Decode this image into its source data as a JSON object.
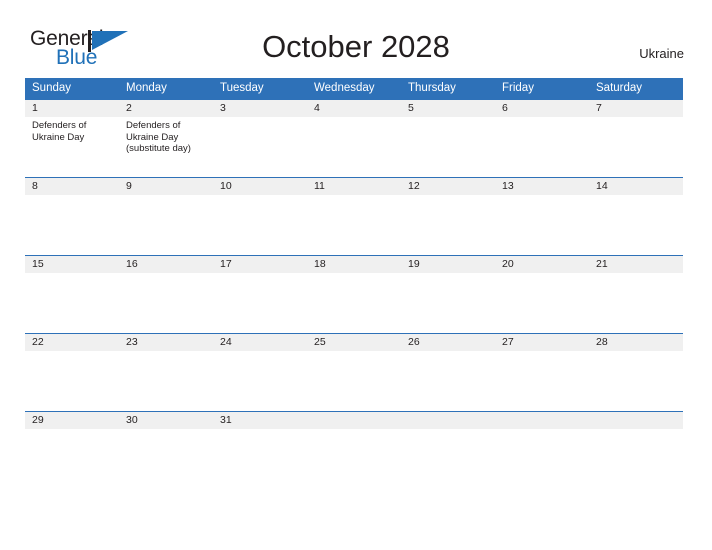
{
  "brand": {
    "name_part1": "General",
    "name_part2": "Blue",
    "flag_icon": "general-blue-flag-icon"
  },
  "header": {
    "title": "October 2028",
    "country": "Ukraine"
  },
  "colors": {
    "header_blue": "#2e71b8",
    "daynum_band": "#f0f0f0",
    "brand_blue": "#2071b8",
    "text": "#231f20"
  },
  "calendar": {
    "day_headers": [
      "Sunday",
      "Monday",
      "Tuesday",
      "Wednesday",
      "Thursday",
      "Friday",
      "Saturday"
    ],
    "weeks": [
      {
        "days": [
          {
            "number": "1",
            "events": [
              "Defenders of Ukraine Day"
            ]
          },
          {
            "number": "2",
            "events": [
              "Defenders of Ukraine Day (substitute day)"
            ]
          },
          {
            "number": "3",
            "events": []
          },
          {
            "number": "4",
            "events": []
          },
          {
            "number": "5",
            "events": []
          },
          {
            "number": "6",
            "events": []
          },
          {
            "number": "7",
            "events": []
          }
        ]
      },
      {
        "days": [
          {
            "number": "8",
            "events": []
          },
          {
            "number": "9",
            "events": []
          },
          {
            "number": "10",
            "events": []
          },
          {
            "number": "11",
            "events": []
          },
          {
            "number": "12",
            "events": []
          },
          {
            "number": "13",
            "events": []
          },
          {
            "number": "14",
            "events": []
          }
        ]
      },
      {
        "days": [
          {
            "number": "15",
            "events": []
          },
          {
            "number": "16",
            "events": []
          },
          {
            "number": "17",
            "events": []
          },
          {
            "number": "18",
            "events": []
          },
          {
            "number": "19",
            "events": []
          },
          {
            "number": "20",
            "events": []
          },
          {
            "number": "21",
            "events": []
          }
        ]
      },
      {
        "days": [
          {
            "number": "22",
            "events": []
          },
          {
            "number": "23",
            "events": []
          },
          {
            "number": "24",
            "events": []
          },
          {
            "number": "25",
            "events": []
          },
          {
            "number": "26",
            "events": []
          },
          {
            "number": "27",
            "events": []
          },
          {
            "number": "28",
            "events": []
          }
        ]
      },
      {
        "days": [
          {
            "number": "29",
            "events": []
          },
          {
            "number": "30",
            "events": []
          },
          {
            "number": "31",
            "events": []
          },
          {
            "number": "",
            "events": []
          },
          {
            "number": "",
            "events": []
          },
          {
            "number": "",
            "events": []
          },
          {
            "number": "",
            "events": []
          }
        ]
      }
    ]
  }
}
